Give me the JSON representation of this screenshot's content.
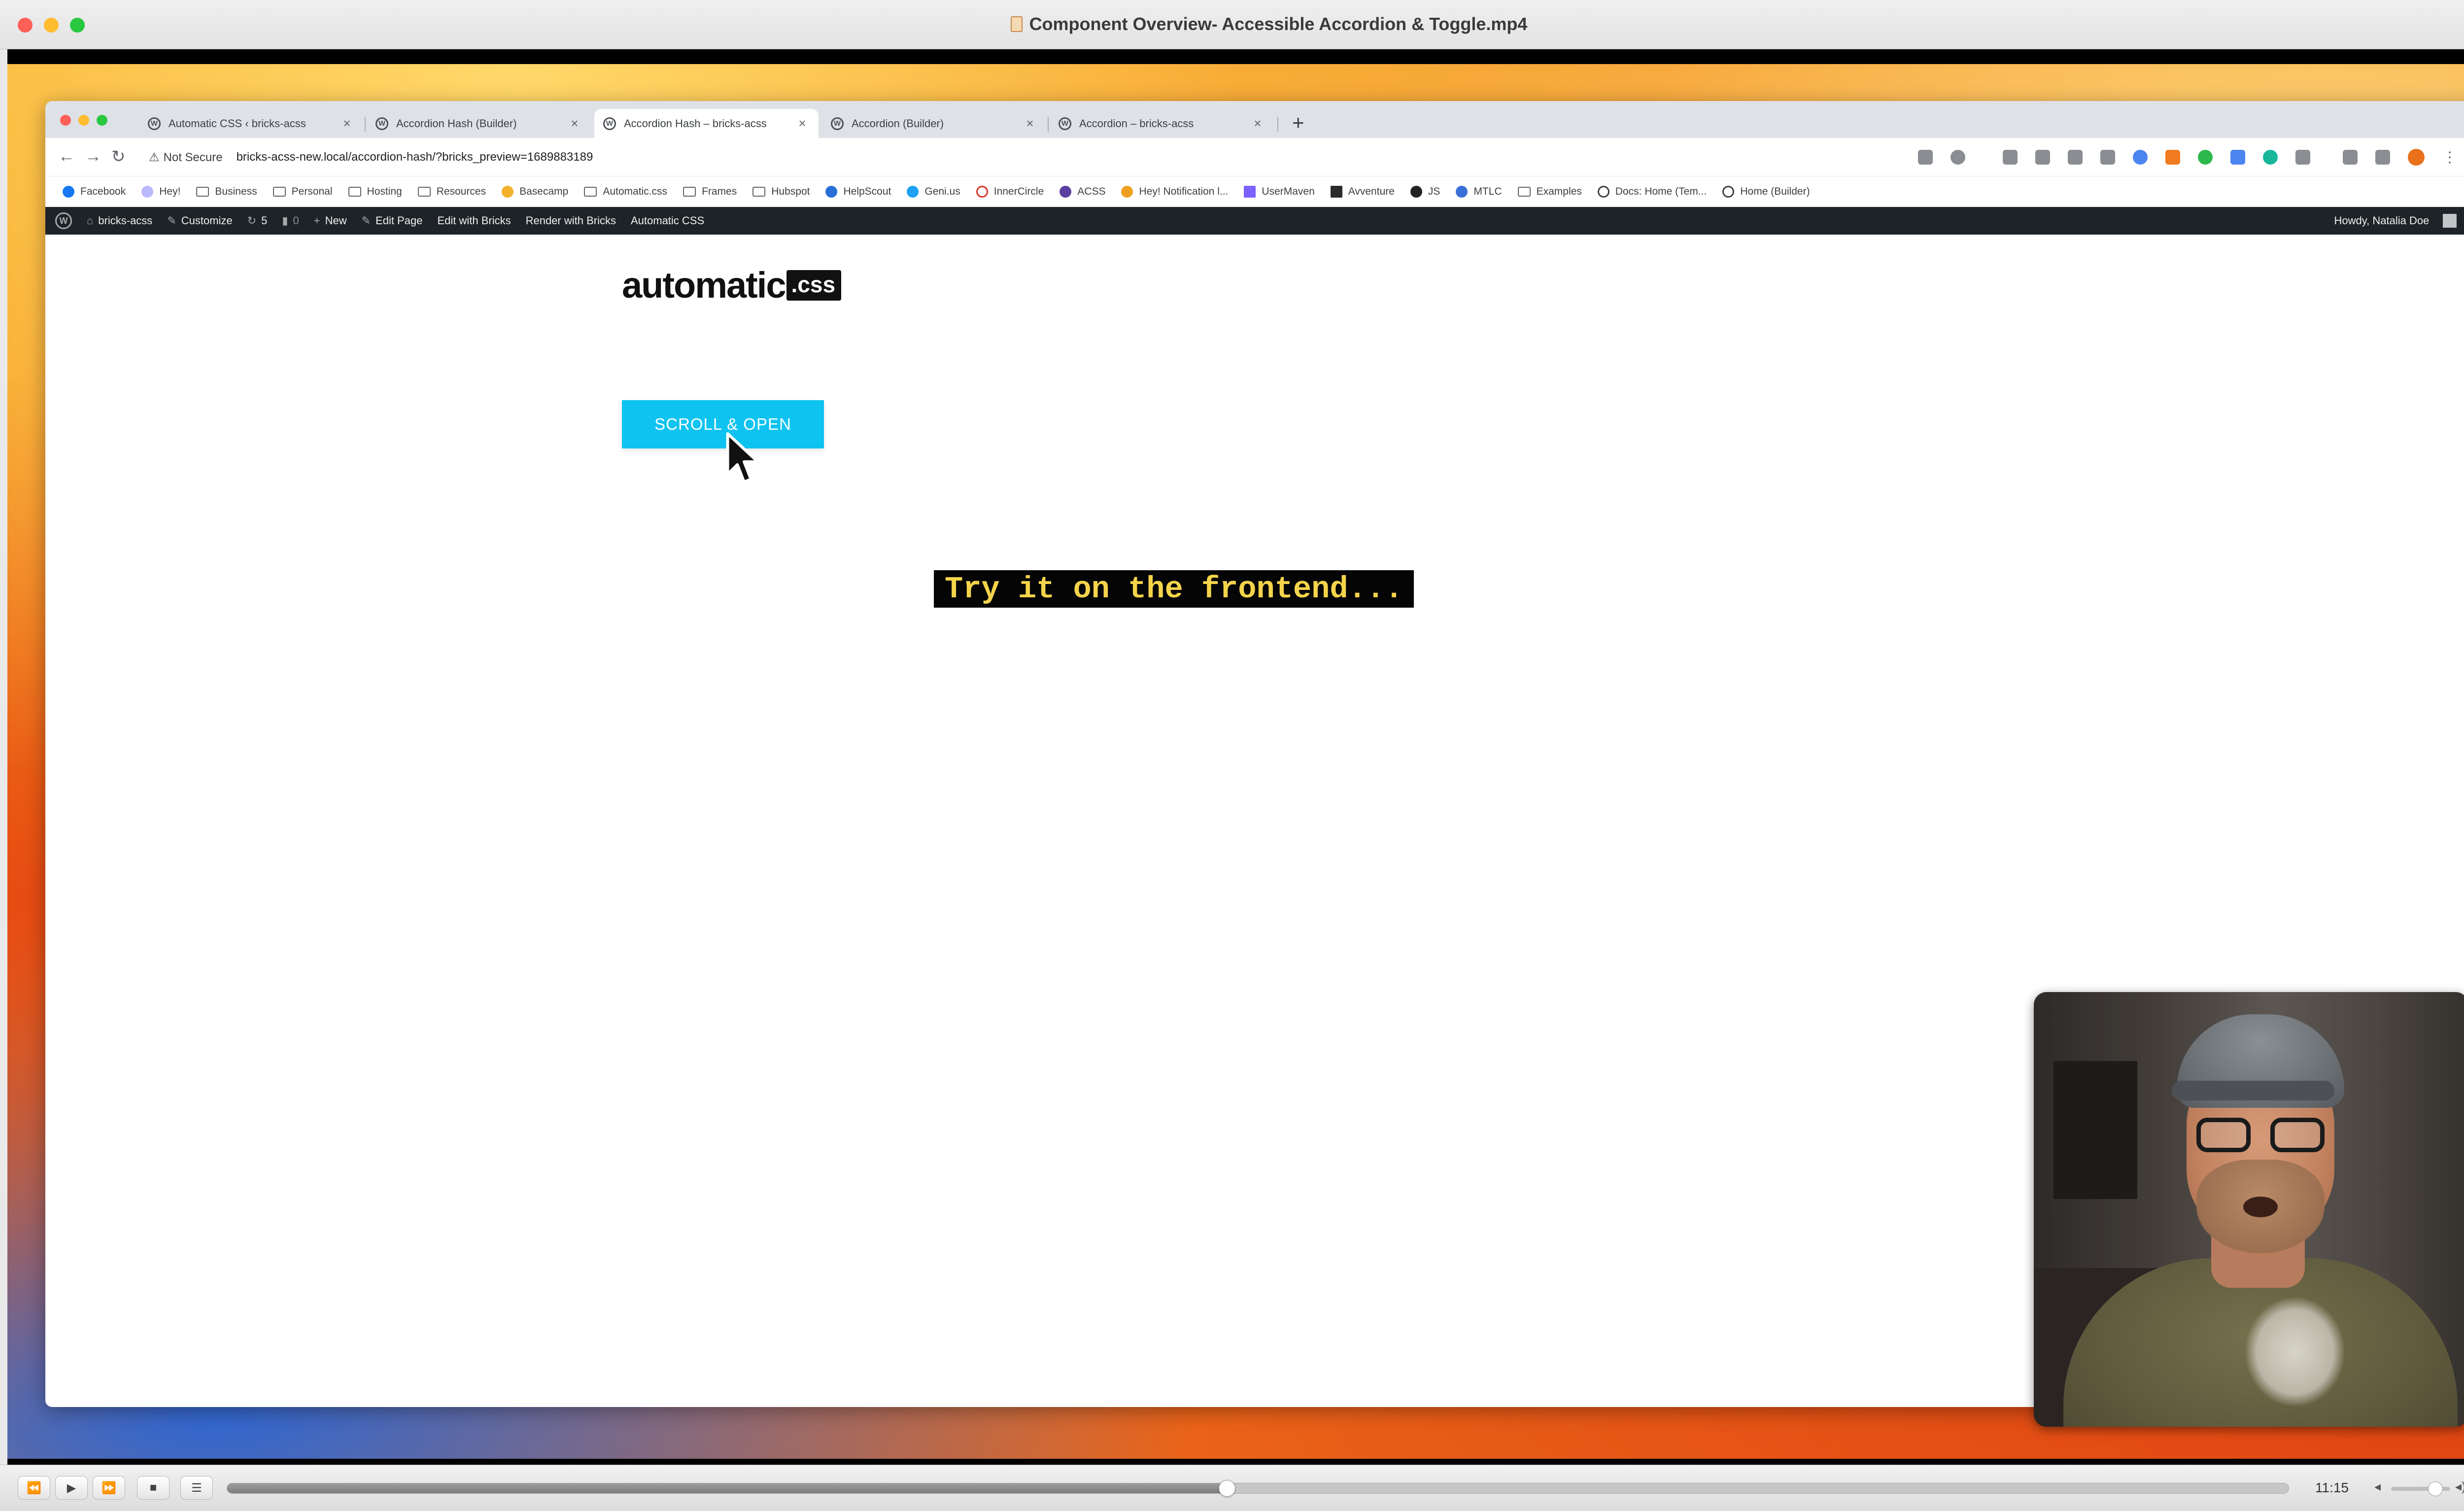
{
  "player": {
    "title": "Component Overview- Accessible Accordion & Toggle.mp4",
    "time": "11:15",
    "progress": 0.485,
    "volume": 0.75,
    "controls": {
      "rewind": "⏪",
      "play": "▶",
      "fast_forward": "⏩",
      "stop": "■",
      "chapters": "☰",
      "fullscreen": "⤢"
    }
  },
  "browser": {
    "tabs": [
      {
        "label": "Automatic CSS ‹ bricks-acss",
        "close": "×"
      },
      {
        "label": "Accordion Hash (Builder)",
        "close": "×"
      },
      {
        "label": "Accordion Hash – bricks-acss",
        "close": "×"
      },
      {
        "label": "Accordion (Builder)",
        "close": "×"
      },
      {
        "label": "Accordion – bricks-acss",
        "close": "×"
      }
    ],
    "new_tab": "+",
    "tab_menu": "⌄",
    "nav": {
      "back": "←",
      "forward": "→",
      "reload": "↻"
    },
    "security_label": "Not Secure",
    "security_icon": "⚠",
    "url": "bricks-acss-new.local/accordion-hash/?bricks_preview=1689883189",
    "bookmarks": [
      "Facebook",
      "Hey!",
      "Business",
      "Personal",
      "Hosting",
      "Resources",
      "Basecamp",
      "Automatic.css",
      "Frames",
      "Hubspot",
      "HelpScout",
      "Geni.us",
      "InnerCircle",
      "ACSS",
      "Hey! Notification l...",
      "UserMaven",
      "Avventure",
      "JS",
      "MTLC",
      "Examples",
      "Docs: Home (Tem...",
      "Home (Builder)"
    ]
  },
  "admin_bar": {
    "logo": "W",
    "site": "bricks-acss",
    "customize": "Customize",
    "updates_count": "5",
    "comments_count": "0",
    "new": "New",
    "edit_page": "Edit Page",
    "edit_with_bricks": "Edit with Bricks",
    "render_with_bricks": "Render with Bricks",
    "automatic_css": "Automatic CSS",
    "howdy": "Howdy, Natalia Doe",
    "search_icon": "⌕"
  },
  "page": {
    "logo_text": "automatic",
    "logo_chip": ".css",
    "cta_label": "SCROLL & OPEN",
    "caption": "Try it on the frontend..."
  },
  "colors": {
    "cta": "#0ec3f0",
    "caption_text": "#f5d44b",
    "admin_bar": "#1d2327"
  }
}
